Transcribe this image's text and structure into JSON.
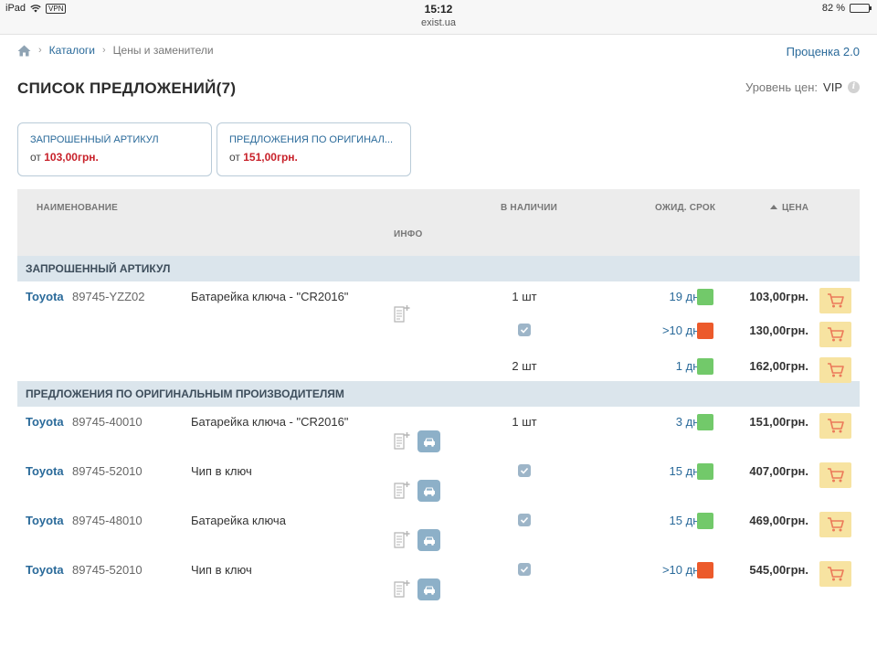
{
  "statusbar": {
    "device": "iPad",
    "vpn": "VPN",
    "time": "15:12",
    "url": "exist.ua",
    "battery": "82 %",
    "battery_level": 0.82
  },
  "breadcrumb": {
    "home_icon": "home-icon",
    "items": [
      "Каталоги",
      "Цены и заменители"
    ]
  },
  "top_link": "Проценка 2.0",
  "page_title": "СПИСОК ПРЕДЛОЖЕНИЙ(7)",
  "price_level": {
    "label": "Уровень цен:",
    "value": "VIP",
    "icon": "info-icon"
  },
  "cards": [
    {
      "title": "ЗАПРОШЕННЫЙ АРТИКУЛ",
      "from": "от",
      "price": "103,00грн."
    },
    {
      "title": "ПРЕДЛОЖЕНИЯ ПО ОРИГИНАЛ...",
      "from": "от",
      "price": "151,00грн."
    }
  ],
  "table": {
    "headers": {
      "name": "НАИМЕНОВАНИЕ",
      "info": "ИНФО",
      "stock": "В НАЛИЧИИ",
      "term": "ОЖИД. СРОК",
      "price": "ЦЕНА"
    },
    "sections": [
      {
        "title": "ЗАПРОШЕННЫЙ АРТИКУЛ",
        "rows": [
          {
            "brand": "Toyota",
            "article": "89745-YZZ02",
            "desc": "Батарейка ключа - \"CR2016\"",
            "stock": "1 шт",
            "in_stock_check": false,
            "term": "19 дн.",
            "status": "green",
            "price": "103,00грн.",
            "has_doc": true,
            "has_car": false
          },
          {
            "brand": "",
            "article": "",
            "desc": "",
            "stock": "",
            "in_stock_check": true,
            "term": ">10 дн.",
            "status": "red",
            "price": "130,00грн.",
            "has_doc": false,
            "has_car": false
          },
          {
            "brand": "",
            "article": "",
            "desc": "",
            "stock": "2 шт",
            "in_stock_check": false,
            "term": "1 дн.",
            "status": "green",
            "price": "162,00грн.",
            "has_doc": false,
            "has_car": false
          }
        ]
      },
      {
        "title": "ПРЕДЛОЖЕНИЯ ПО ОРИГИНАЛЬНЫМ ПРОИЗВОДИТЕЛЯМ",
        "rows": [
          {
            "brand": "Toyota",
            "article": "89745-40010",
            "desc": "Батарейка ключа - \"CR2016\"",
            "stock": "1 шт",
            "in_stock_check": false,
            "term": "3 дн.",
            "status": "green",
            "price": "151,00грн.",
            "has_doc": true,
            "has_car": true
          },
          {
            "brand": "Toyota",
            "article": "89745-52010",
            "desc": "Чип в ключ",
            "stock": "",
            "in_stock_check": true,
            "term": "15 дн.",
            "status": "green",
            "price": "407,00грн.",
            "has_doc": true,
            "has_car": true
          },
          {
            "brand": "Toyota",
            "article": "89745-48010",
            "desc": "Батарейка ключа",
            "stock": "",
            "in_stock_check": true,
            "term": "15 дн.",
            "status": "green",
            "price": "469,00грн.",
            "has_doc": true,
            "has_car": true
          },
          {
            "brand": "Toyota",
            "article": "89745-52010",
            "desc": "Чип в ключ",
            "stock": "",
            "in_stock_check": true,
            "term": ">10 дн.",
            "status": "red",
            "price": "545,00грн.",
            "has_doc": true,
            "has_car": true
          }
        ]
      }
    ]
  },
  "colors": {
    "green": "#72c96a",
    "red": "#ec5a2b",
    "link": "#2a6a9a",
    "price_red": "#c8212a",
    "cart_bg": "#f7e3a1",
    "cart_icon": "#ec7a5a"
  },
  "icons": {
    "cart": "cart-icon",
    "doc": "document-icon",
    "car": "car-icon",
    "check": "checkbox-checked-icon"
  }
}
